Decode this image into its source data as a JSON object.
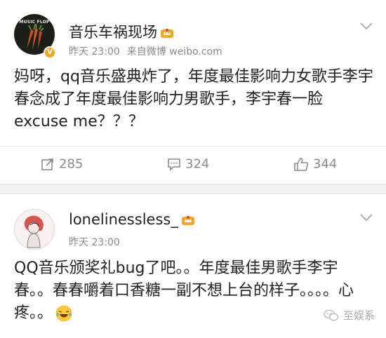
{
  "posts": [
    {
      "avatar_text": "MUSIC FLOP",
      "username": "音乐车祸现场",
      "meta_time": "昨天 23:00",
      "meta_source": "来自微博 weibo.com",
      "content": "妈呀，qq音乐盛典炸了，年度最佳影响力女歌手李宇春念成了年度最佳影响力男歌手，李宇春一脸excuse me？？？",
      "actions": {
        "repost": "285",
        "comment": "324",
        "like": "344"
      }
    },
    {
      "username": "lonelinessless_",
      "meta_time": "昨天 23:00",
      "content": "QQ音乐颁奖礼bug了吧。。年度最佳男歌手李宇春。。春春嚼着口香糖一副不想上台的样子。。。。心疼。。"
    }
  ],
  "watermark": "至娱系",
  "colors": {
    "text": "#222222",
    "meta": "#8a8a8a",
    "verified": "#f5a623",
    "separator": "#f2f2f2"
  },
  "icons": {
    "repost": "repost-icon",
    "comment": "comment-icon",
    "like": "like-icon",
    "chevron": "chevron-down-icon",
    "member": "member-crown-icon",
    "emoji": "laugh-cry-emoji",
    "watermark": "wechat-icon"
  }
}
